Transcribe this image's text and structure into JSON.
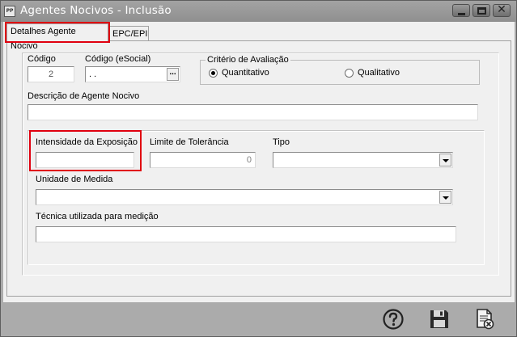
{
  "window": {
    "app_icon": "PP",
    "title": "Agentes Nocivos - Inclusão"
  },
  "tabs": [
    {
      "label": "Detalhes Agente Nocivo",
      "active": true
    },
    {
      "label": "EPC/EPI",
      "active": false
    }
  ],
  "form": {
    "codigo": {
      "label": "Código",
      "value": "2"
    },
    "codigo_esocial": {
      "label": "Código (eSocial)",
      "value": ". .",
      "button": "..."
    },
    "criterio": {
      "legend": "Critério de Avaliação",
      "options": [
        {
          "label": "Quantitativo",
          "selected": true
        },
        {
          "label": "Qualitativo",
          "selected": false
        }
      ]
    },
    "descricao": {
      "label": "Descrição de Agente Nocivo",
      "value": ""
    },
    "intensidade": {
      "label": "Intensidade da Exposição",
      "value": ""
    },
    "limite": {
      "label": "Limite de Tolerância",
      "value": "0"
    },
    "tipo": {
      "label": "Tipo",
      "value": ""
    },
    "unidade": {
      "label": "Unidade de Medida",
      "value": ""
    },
    "tecnica": {
      "label": "Técnica utilizada para medição",
      "value": ""
    }
  },
  "toolbar": {
    "help_icon": "help-icon",
    "save_icon": "save-icon",
    "cancel_icon": "cancel-document-icon"
  },
  "colors": {
    "highlight": "#e0000f",
    "titlebar": "#969696",
    "client": "#f0f0f0"
  }
}
